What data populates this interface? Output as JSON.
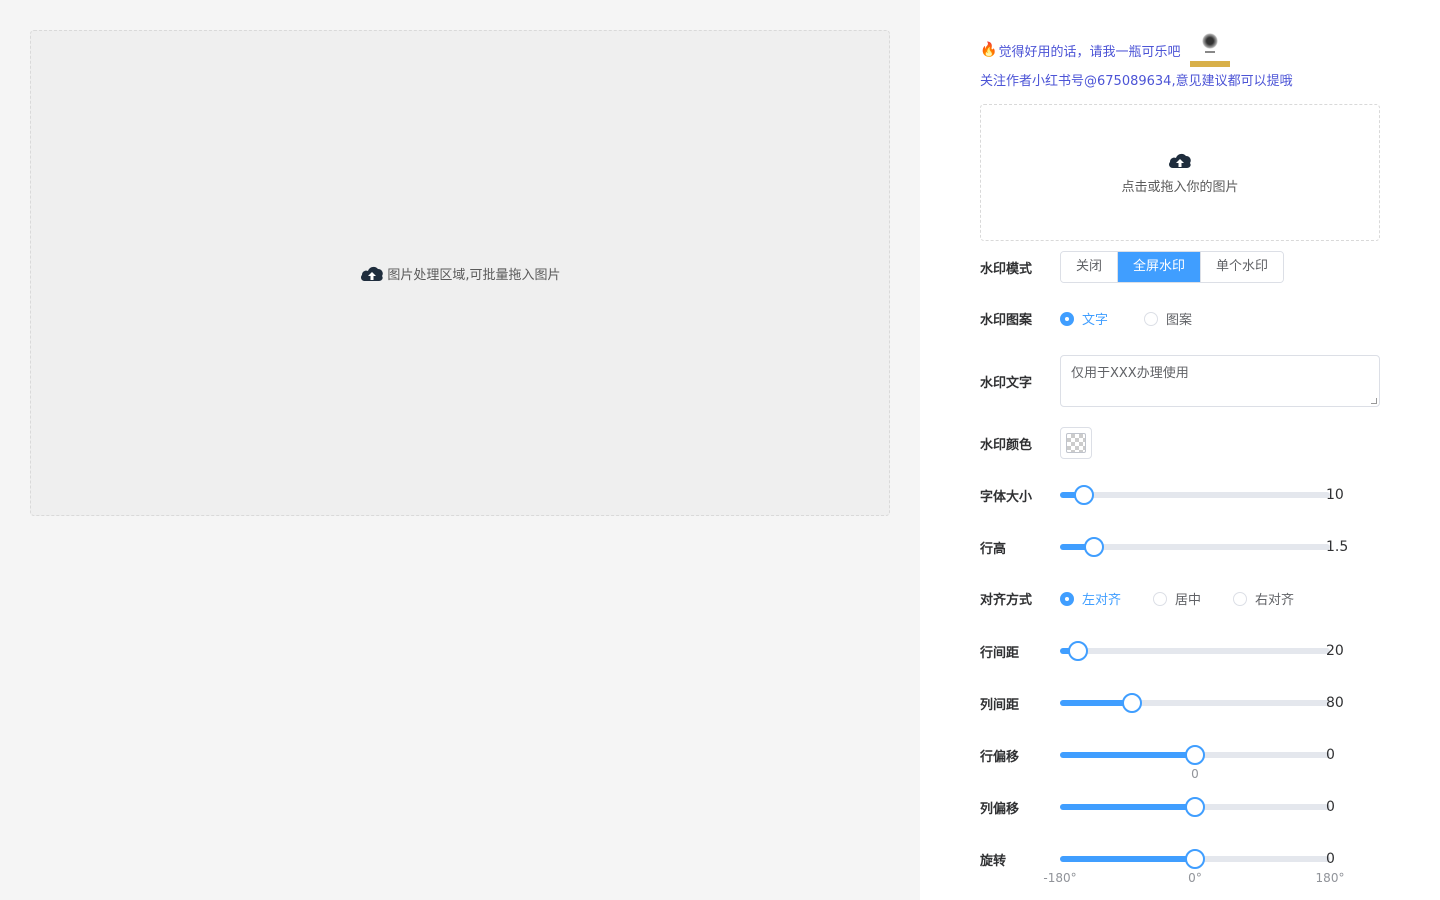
{
  "canvas": {
    "hint": "图片处理区域,可批量拖入图片",
    "icon": "cloud-upload-icon"
  },
  "promo": {
    "fire_icon": "🔥",
    "line1": "觉得好用的话，请我一瓶可乐吧",
    "line2": "关注作者小红书号@675089634,意见建议都可以提哦",
    "accent": "#4c54d6"
  },
  "upload": {
    "label": "点击或拖入你的图片",
    "icon": "cloud-upload-icon"
  },
  "mode": {
    "label": "水印模式",
    "options": [
      "关闭",
      "全屏水印",
      "单个水印"
    ],
    "selected": "全屏水印"
  },
  "pattern": {
    "label": "水印图案",
    "options": [
      "文字",
      "图案"
    ],
    "selected": "文字"
  },
  "text": {
    "label": "水印文字",
    "value": "仅用于XXX办理使用"
  },
  "color": {
    "label": "水印颜色",
    "value": "transparent"
  },
  "font_size": {
    "label": "字体大小",
    "value": "10",
    "fraction": 0.09
  },
  "line_height": {
    "label": "行高",
    "value": "1.5",
    "fraction": 0.125
  },
  "align": {
    "label": "对齐方式",
    "options": [
      "左对齐",
      "居中",
      "右对齐"
    ],
    "selected": "左对齐"
  },
  "row_gap": {
    "label": "行间距",
    "value": "20",
    "fraction": 0.065
  },
  "col_gap": {
    "label": "列间距",
    "value": "80",
    "fraction": 0.265
  },
  "row_offset": {
    "label": "行偏移",
    "value": "0",
    "fraction": 0.5,
    "under_label": "0"
  },
  "col_offset": {
    "label": "列偏移",
    "value": "0",
    "fraction": 0.5
  },
  "rotate": {
    "label": "旋转",
    "value": "0",
    "fraction": 0.5,
    "marks": [
      "-180°",
      "0°",
      "180°"
    ]
  },
  "theme": {
    "primary": "#409eff",
    "track": "#e4e7ed"
  }
}
